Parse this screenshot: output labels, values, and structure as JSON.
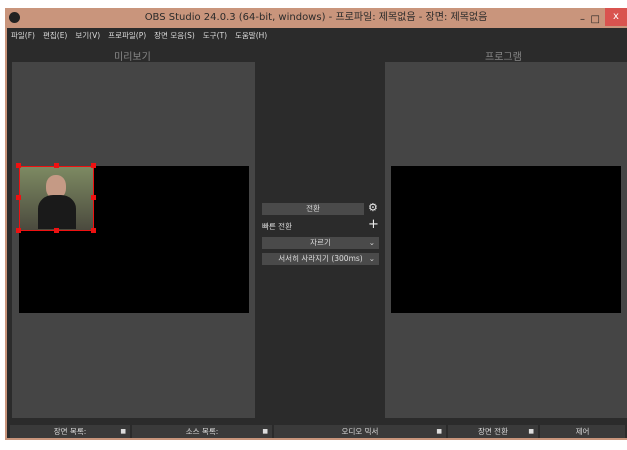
{
  "window": {
    "title": "OBS Studio 24.0.3 (64-bit, windows) - 프로파일: 제목없음 - 장면: 제목없음",
    "minimize": "–",
    "maximize": "□",
    "close": "x"
  },
  "menu": [
    "파일(F)",
    "편집(E)",
    "보기(V)",
    "프로파일(P)",
    "장면 모음(S)",
    "도구(T)",
    "도움말(H)"
  ],
  "preview_label": "미리보기",
  "program_label": "프로그램",
  "transition": {
    "button": "전환",
    "quick": "빠른 전환",
    "plus": "+",
    "dropdown1": "자르기",
    "dropdown2": "서서히 사라지기 (300ms)",
    "chevron": "⌄",
    "gear": "⚙"
  },
  "docks": [
    {
      "label": "장면 목록:"
    },
    {
      "label": "소스 목록:"
    },
    {
      "label": "오디오 믹서"
    },
    {
      "label": "장면 전환"
    },
    {
      "label": "제어"
    }
  ],
  "colors": {
    "titlebar": "#c9957c",
    "selection": "#ee1111"
  }
}
